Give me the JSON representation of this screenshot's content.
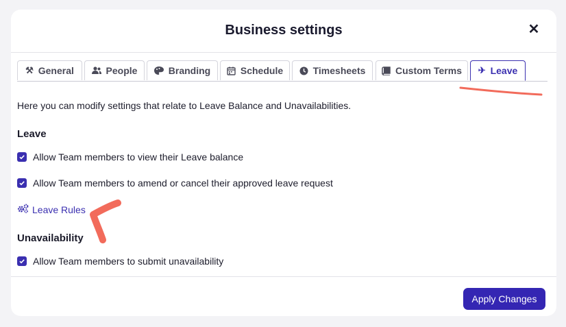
{
  "modal": {
    "title": "Business settings",
    "close_icon": "close-icon"
  },
  "tabs": [
    {
      "label": "General",
      "icon": "tools-icon"
    },
    {
      "label": "People",
      "icon": "people-icon"
    },
    {
      "label": "Branding",
      "icon": "palette-icon"
    },
    {
      "label": "Schedule",
      "icon": "calendar-icon"
    },
    {
      "label": "Timesheets",
      "icon": "clock-icon"
    },
    {
      "label": "Custom Terms",
      "icon": "book-icon"
    },
    {
      "label": "Leave",
      "icon": "plane-icon",
      "active": true
    }
  ],
  "content": {
    "description": "Here you can modify settings that relate to Leave Balance and Unavailabilities.",
    "leave_section": {
      "title": "Leave",
      "options": [
        {
          "label": "Allow Team members to view their Leave balance",
          "checked": true
        },
        {
          "label": "Allow Team members to amend or cancel their approved leave request",
          "checked": true
        }
      ],
      "link_label": "Leave Rules",
      "link_icon": "gears-icon"
    },
    "unavailability_section": {
      "title": "Unavailability",
      "options": [
        {
          "label": "Allow Team members to submit unavailability",
          "checked": true
        }
      ]
    }
  },
  "footer": {
    "apply_label": "Apply Changes"
  },
  "colors": {
    "accent": "#3426b3",
    "annotation": "#f26b5b"
  }
}
